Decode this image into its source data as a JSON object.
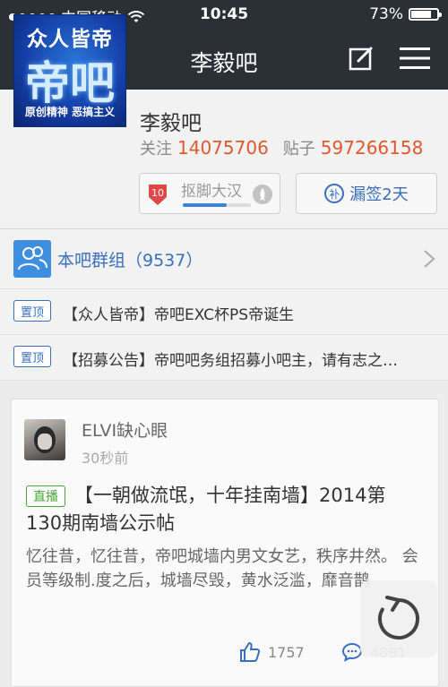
{
  "status_bar": {
    "carrier": "中国移动",
    "time": "10:45",
    "battery": "73%"
  },
  "nav": {
    "title": "李毅吧"
  },
  "forum": {
    "logo_line1": "众人皆帝",
    "logo_line2": "帝吧",
    "logo_line3": "原创精神  恶搞主义",
    "name": "李毅吧",
    "follow_label": "关注",
    "follow_count": "14075706",
    "posts_label": "贴子",
    "posts_count": "597266158",
    "level": "10",
    "level_name": "抠脚大汉",
    "level_progress": 0.65,
    "sign_label": "漏签2天"
  },
  "group": {
    "label": "本吧群组（9537）"
  },
  "pinned": [
    {
      "tag": "置顶",
      "title": "【众人皆帝】帝吧EXC杯PS帝诞生"
    },
    {
      "tag": "置顶",
      "title": "【招募公告】帝吧吧务组招募小吧主，请有志之…"
    }
  ],
  "post": {
    "username": "ELVI缺心眼",
    "time": "30秒前",
    "tag": "直播",
    "title": "【一朝做流氓，十年挂南墙】2014第130期南墙公示帖",
    "body": "忆往昔，忆往昔，帝吧城墙内男文女艺，秩序井然。 会员等级制.度之后，城墙尽毁，黄水泛滥，靡音鹊",
    "likes": "1757",
    "comments": "4891"
  },
  "colors": {
    "bar": "#2b2f36",
    "accent_blue": "#3a6fbf",
    "count_orange": "#e0592a",
    "live_green": "#4aa53a"
  }
}
